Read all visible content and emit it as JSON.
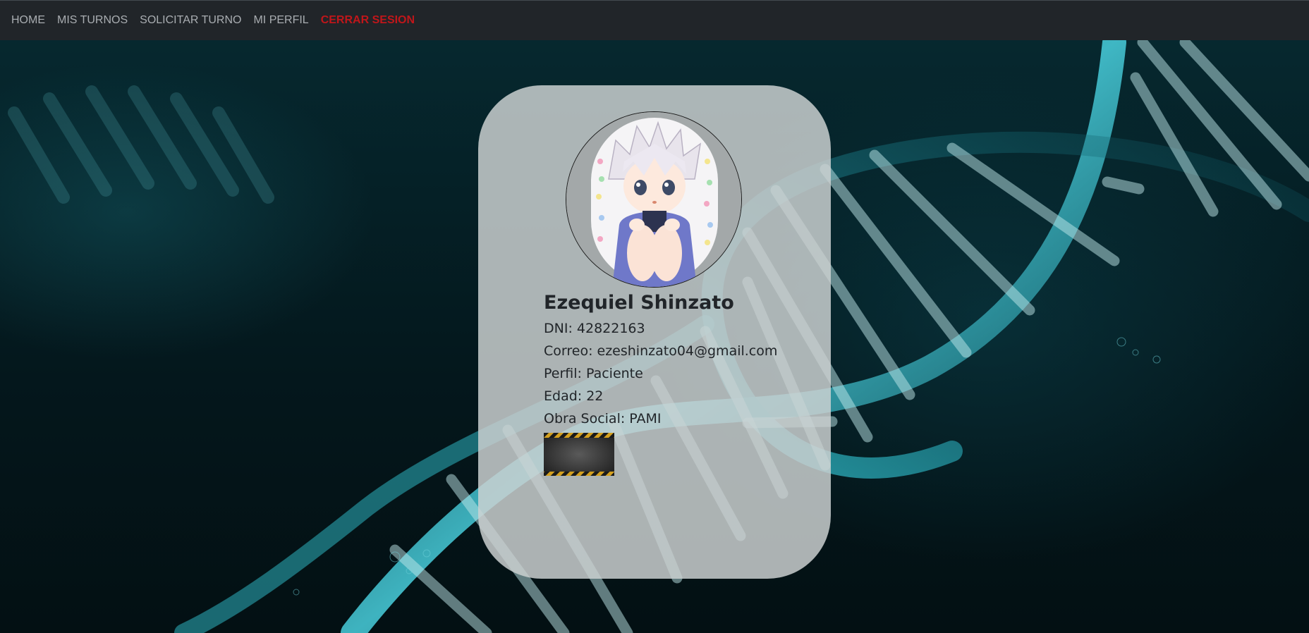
{
  "nav": {
    "home": "HOME",
    "mis_turnos": "MIS TURNOS",
    "solicitar_turno": "SOLICITAR TURNO",
    "mi_perfil": "MI PERFIL",
    "cerrar_sesion": "CERRAR SESION"
  },
  "profile": {
    "name": "Ezequiel Shinzato",
    "dni": "DNI: 42822163",
    "correo": "Correo: ezeshinzato04@gmail.com",
    "perfil": "Perfil: Paciente",
    "edad": "Edad: 22",
    "obra_social": "Obra Social: PAMI"
  },
  "colors": {
    "navbar": "#212529",
    "nav_link": "#a9adb1",
    "logout": "#c0161a",
    "card": "#cdd2d2",
    "background": "#041419",
    "dna_accent": "#3fb8c6"
  }
}
